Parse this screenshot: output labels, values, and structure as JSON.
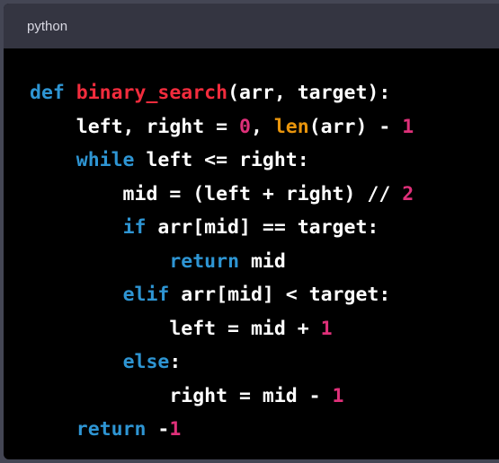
{
  "header": {
    "language": "python"
  },
  "colors": {
    "keyword": "#2e95d3",
    "function": "#f22c3d",
    "number": "#df3079",
    "builtin": "#e9950c",
    "text": "#ffffff"
  },
  "code_lines": [
    [
      [
        "def ",
        "kw"
      ],
      [
        "binary_search",
        "fn"
      ],
      [
        "(arr, target):",
        "tx"
      ]
    ],
    [
      [
        "    left, right = ",
        "tx"
      ],
      [
        "0",
        "num"
      ],
      [
        ", ",
        "tx"
      ],
      [
        "len",
        "bi"
      ],
      [
        "(arr) - ",
        "tx"
      ],
      [
        "1",
        "num"
      ]
    ],
    [
      [
        "    ",
        "tx"
      ],
      [
        "while",
        "kw"
      ],
      [
        " left <= right:",
        "tx"
      ]
    ],
    [
      [
        "        mid = (left + right) // ",
        "tx"
      ],
      [
        "2",
        "num"
      ]
    ],
    [
      [
        "        ",
        "tx"
      ],
      [
        "if",
        "kw"
      ],
      [
        " arr[mid] == target:",
        "tx"
      ]
    ],
    [
      [
        "            ",
        "tx"
      ],
      [
        "return",
        "kw"
      ],
      [
        " mid",
        "tx"
      ]
    ],
    [
      [
        "        ",
        "tx"
      ],
      [
        "elif",
        "kw"
      ],
      [
        " arr[mid] < target:",
        "tx"
      ]
    ],
    [
      [
        "            left = mid + ",
        "tx"
      ],
      [
        "1",
        "num"
      ]
    ],
    [
      [
        "        ",
        "tx"
      ],
      [
        "else",
        "kw"
      ],
      [
        ":",
        "tx"
      ]
    ],
    [
      [
        "            right = mid - ",
        "tx"
      ],
      [
        "1",
        "num"
      ]
    ],
    [
      [
        "    ",
        "tx"
      ],
      [
        "return",
        "kw"
      ],
      [
        " -",
        "tx"
      ],
      [
        "1",
        "num"
      ]
    ]
  ]
}
